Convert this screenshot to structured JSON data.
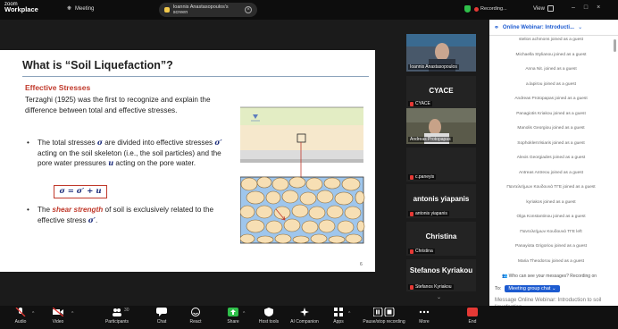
{
  "topbar": {
    "logo_line1": "zoom",
    "logo_line2": "Workplace",
    "meeting_label": "Meeting",
    "share_text": "Ioannis Anastasopoulos's screen",
    "recording_label": "Recording...",
    "view_label": "View"
  },
  "slide": {
    "title": "What is “Soil Liquefaction”?",
    "subtitle": "Effective Stresses",
    "para": "Terzaghi (1925) was the first to recognize and explain the difference between total and effective stresses.",
    "bullet1_a": "The total stresses ",
    "bullet1_sig": "σ",
    "bullet1_b": " are divided into effective stresses ",
    "bullet1_sigp": "σ′",
    "bullet1_c": " acting on the soil skeleton (i.e., the soil particles) and the pore water pressures ",
    "bullet1_u": "u",
    "bullet1_d": " acting on the pore water.",
    "equation": "σ = σ′ + u",
    "bullet2_a": "The ",
    "bullet2_ss": "shear strength",
    "bullet2_b": " of soil is exclusively related to the  effective stress ",
    "bullet2_sigp": "σ′",
    "bullet2_c": ".",
    "page": "6"
  },
  "gallery": [
    {
      "name": "Ioannis Anastasopoulos",
      "type": "video"
    },
    {
      "big": "CYACE",
      "name": "CYACE",
      "type": "name"
    },
    {
      "name": "Andreas Protopapas",
      "type": "video"
    },
    {
      "name": "c.paneyis",
      "type": "blank"
    },
    {
      "big": "antonis yiapanis",
      "name": "antonis yiapanis",
      "type": "name"
    },
    {
      "big": "Christina",
      "name": "Christina",
      "type": "name"
    },
    {
      "big": "Stefanos Kyriakou",
      "name": "Stefanos Kyriakou",
      "type": "name"
    }
  ],
  "chat": {
    "title": "Online Webinar: Introducti...",
    "messages": [
      "stelios achmons joined as a guest",
      "Michaella Stylianou joined as a guest",
      "Anna Nit. joined as a guest",
      "a.lapirou joined as a guest",
      "Andreas Protopapas joined as a guest",
      "Panagiotis Kriakou joined as a guest",
      "Manolis Georgiou joined as a guest",
      "SophoklesVisiaris joined as a guest",
      "Alexis Georgiades joined as a guest",
      "Antreas Antreou joined as a guest",
      "Παντελεήμων Κουδουνά ΤΓΕ joined as a guest",
      "kyriakos joined as a guest",
      "Olga Konstantinou joined as a guest",
      "Παντελεήμων Κουδουνά ΤΓΕ left",
      "Panayiota Grigoriou joined as a guest",
      "Maria Theodorou joined as a guest"
    ],
    "privacy": "Who can see your messages? Recording on",
    "to_label": "To:",
    "to_value": "Meeting group chat",
    "input_placeholder": "Message Online Webinar: Introduction to soil liquefaction"
  },
  "toolbar": {
    "audio": "Audio",
    "video": "Video",
    "participants": "Participants",
    "participants_count": "30",
    "chat": "Chat",
    "react": "React",
    "share": "Share",
    "host_tools": "Host tools",
    "ai": "AI Companion",
    "apps": "Apps",
    "pause": "Pause/stop recording",
    "more": "More",
    "end": "End"
  }
}
